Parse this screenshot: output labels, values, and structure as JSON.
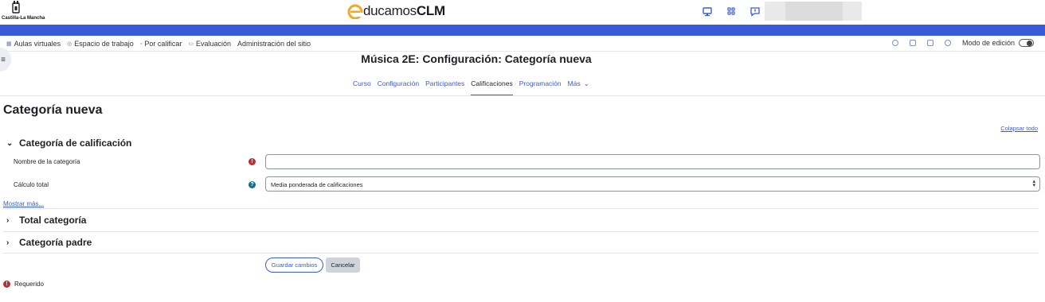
{
  "header": {
    "region_logo_text": "Castilla-La Mancha",
    "brand_prefix": "ducamos",
    "brand_suffix": "CLM",
    "icons": [
      "monitor-icon",
      "apps-grid-icon",
      "messages-icon"
    ],
    "colors": {
      "brand_blue": "#3a5bd8",
      "brand_orange": "#f5a623"
    }
  },
  "subnav": {
    "links": [
      {
        "icon": "grid-icon",
        "label": "Aulas virtuales"
      },
      {
        "icon": "workspace-icon",
        "label": "Espacio de trabajo"
      },
      {
        "icon": "grading-icon",
        "label": "Por calificar"
      },
      {
        "icon": "evaluation-icon",
        "label": "Evaluación"
      },
      {
        "icon": "",
        "label": "Administración del sitio"
      }
    ],
    "edit_mode_label": "Modo de edición",
    "edit_mode_on": false
  },
  "course": {
    "title": "Música 2E: Configuración: Categoría nueva",
    "tabs": [
      {
        "label": "Curso",
        "active": false
      },
      {
        "label": "Configuración",
        "active": false
      },
      {
        "label": "Participantes",
        "active": false
      },
      {
        "label": "Calificaciones",
        "active": true
      },
      {
        "label": "Programación",
        "active": false
      }
    ],
    "more_label": "Más"
  },
  "page": {
    "heading": "Categoría nueva",
    "collapse_all": "Colapsar todo"
  },
  "form": {
    "section_main": "Categoría de calificación",
    "name_label": "Nombre de la categoría",
    "name_value": "",
    "aggregation_label": "Cálculo total",
    "aggregation_value": "Media ponderada de calificaciones",
    "show_more": "Mostrar más...",
    "section_total": "Total categoría",
    "section_parent": "Categoría padre",
    "save_label": "Guardar cambios",
    "cancel_label": "Cancelar",
    "required_label": "Requerido"
  }
}
